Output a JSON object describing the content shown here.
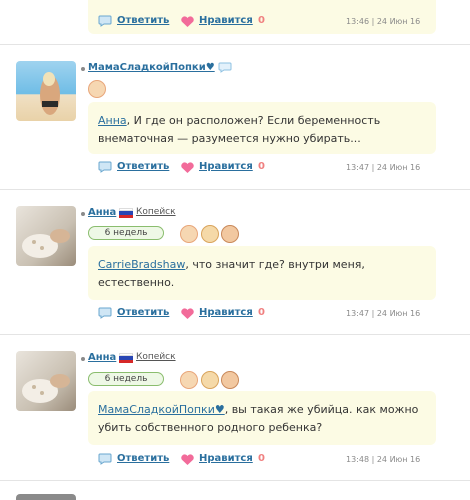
{
  "actions": {
    "reply": "Ответить",
    "like": "Нравится"
  },
  "comments": [
    {
      "likes": "0",
      "time": "13:46",
      "date": "24 Июн 16"
    },
    {
      "user": "МамаСладкойПопки♥",
      "text": "Анна, И где он расположен? Если беременность внематочная — разумеется нужно убирать...",
      "text_mention": "Анна",
      "text_rest": ", И где он расположен? Если беременность внематочная — разумеется нужно убирать...",
      "likes": "0",
      "time": "13:47",
      "date": "24 Июн 16"
    },
    {
      "user": "Анна",
      "city": "Копейск",
      "badge": "6 недель",
      "text_mention": "CarrieBradshaw",
      "text_rest": ", что значит где? внутри меня, естественно.",
      "likes": "0",
      "time": "13:47",
      "date": "24 Июн 16"
    },
    {
      "user": "Анна",
      "city": "Копейск",
      "badge": "6 недель",
      "text_mention": "МамаСладкойПопки♥",
      "text_rest": ", вы такая же убийца. как можно убить собственного родного ребенка?",
      "likes": "0",
      "time": "13:48",
      "date": "24 Июн 16"
    }
  ],
  "colors": {
    "link": "#2a6f9e",
    "bubble": "#fcfbe4",
    "like_count": "#f08080",
    "badge_border": "#8abd6e"
  }
}
